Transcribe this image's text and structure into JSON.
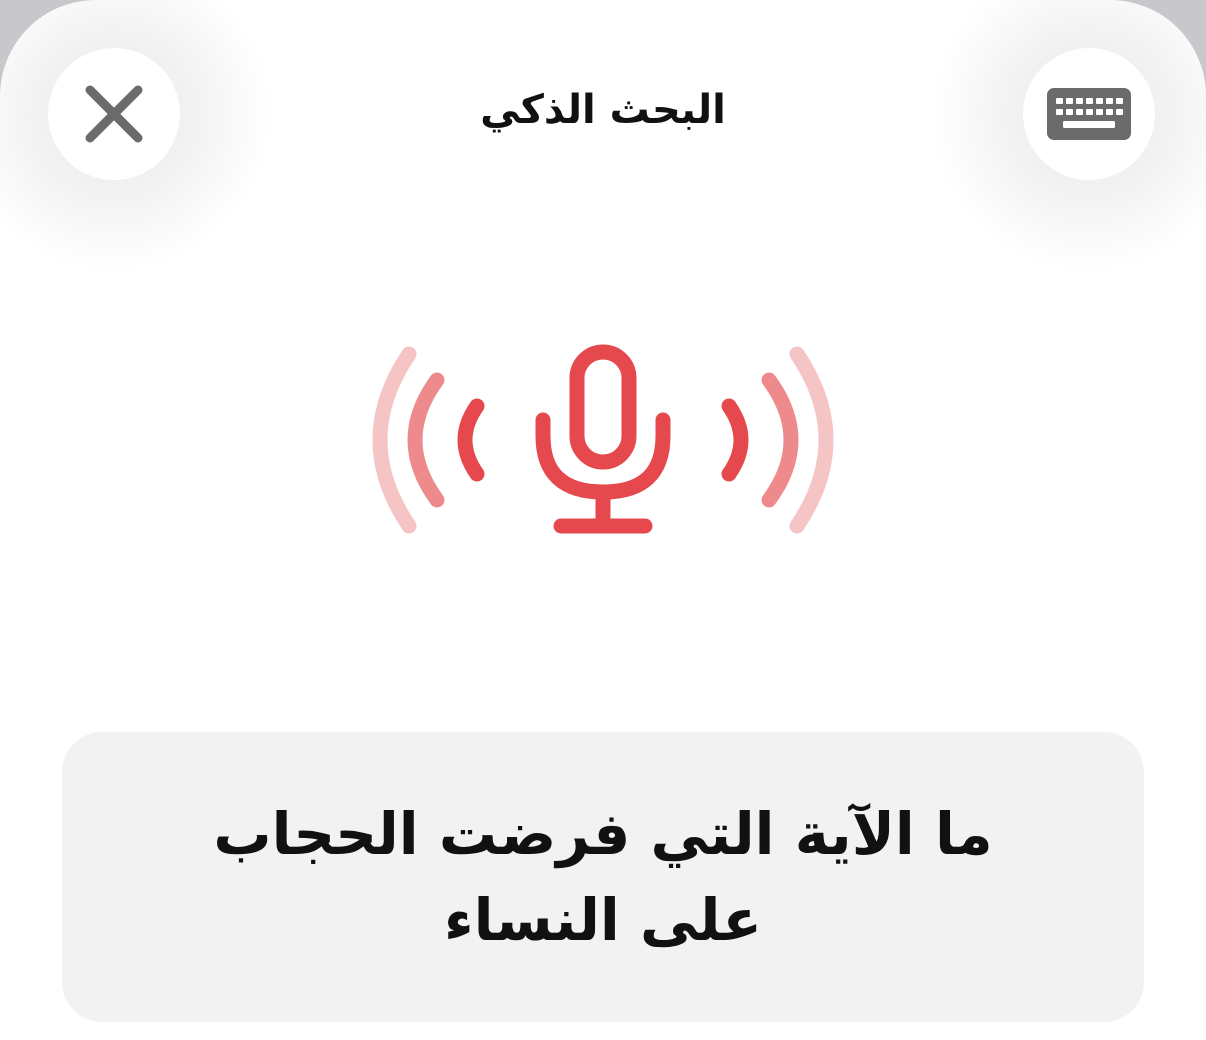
{
  "header": {
    "title": "البحث الذكي",
    "close_icon": "close-icon",
    "keyboard_icon": "keyboard-icon"
  },
  "voice": {
    "icon": "microphone-icon",
    "listening": true,
    "accent_color": "#e5484d",
    "wave_colors": [
      "#e5484d",
      "#ee8a8c",
      "#f5c4c5"
    ]
  },
  "query": {
    "text": "ما الآية التي فرضت الحجاب على النساء"
  }
}
